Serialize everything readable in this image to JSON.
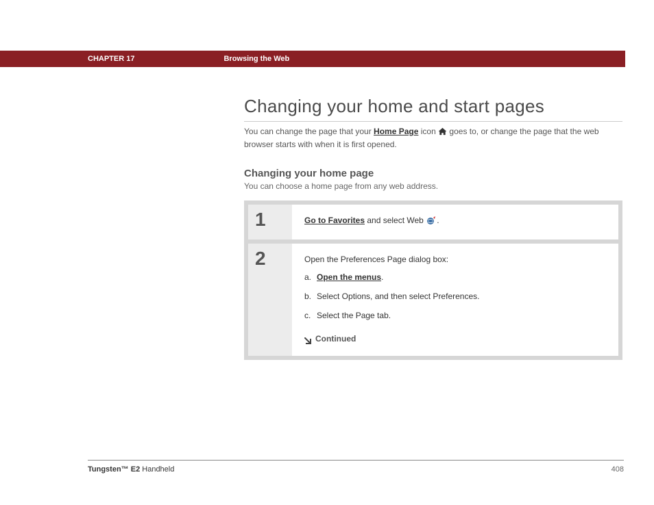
{
  "header": {
    "chapter": "CHAPTER 17",
    "section": "Browsing the Web"
  },
  "title": "Changing your home and start pages",
  "intro_part1": "You can change the page that your ",
  "intro_link": "Home Page",
  "intro_part2": " icon ",
  "intro_part3": " goes to, or change the page that the web browser starts with when it is first opened.",
  "subtitle": "Changing your home page",
  "sub_intro": "You can choose a home page from any web address.",
  "steps": [
    {
      "num": "1",
      "link": "Go to Favorites",
      "after_link": " and select Web ",
      "trailing": "."
    },
    {
      "num": "2",
      "main": "Open the Preferences Page dialog box:",
      "items": [
        {
          "letter": "a.",
          "link": "Open the menus",
          "after": "."
        },
        {
          "letter": "b.",
          "text": "Select Options, and then select Preferences."
        },
        {
          "letter": "c.",
          "text": "Select the Page tab."
        }
      ],
      "continued": "Continued"
    }
  ],
  "footer": {
    "product_bold": "Tungsten™ E2",
    "product_rest": " Handheld",
    "page": "408"
  }
}
